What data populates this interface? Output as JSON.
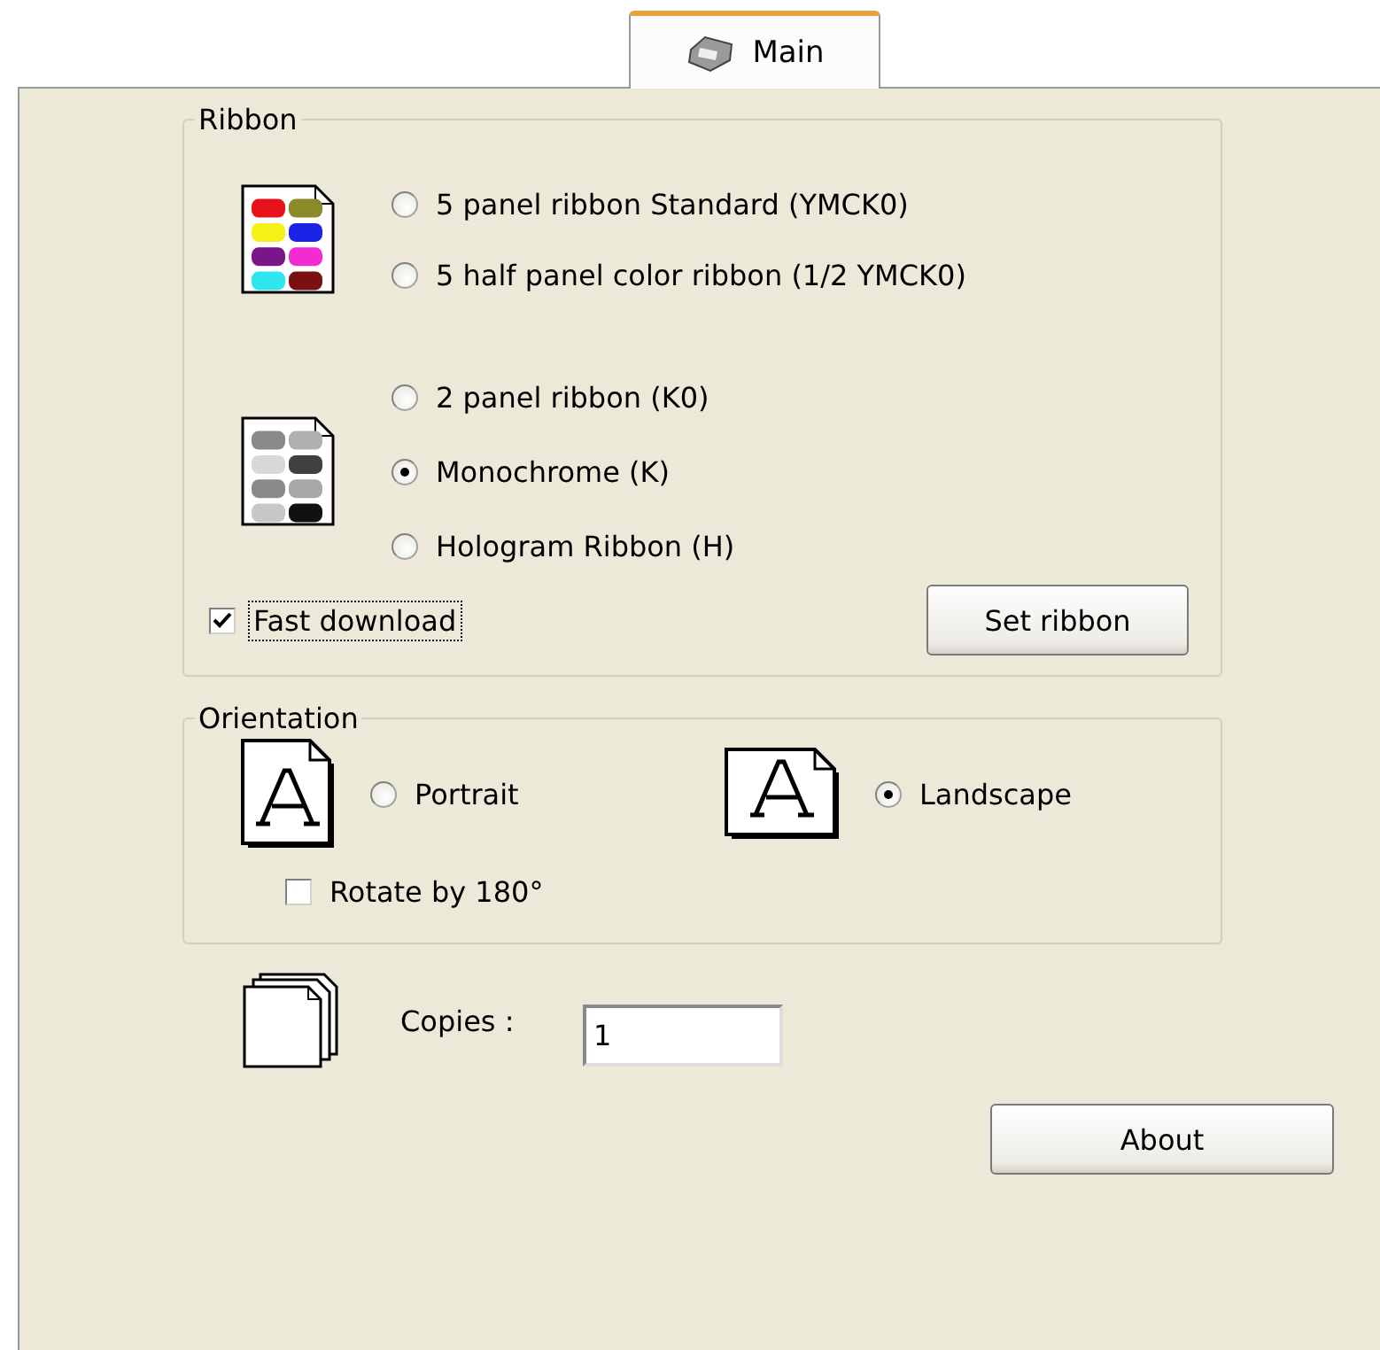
{
  "tabs": [
    {
      "label": "Main",
      "selected": true
    }
  ],
  "ribbon": {
    "title": "Ribbon",
    "groups": [
      {
        "kind": "color",
        "options": [
          {
            "label": "5 panel ribbon Standard (YMCK0)",
            "selected": false
          },
          {
            "label": "5 half panel color ribbon (1/2 YMCK0)",
            "selected": false
          }
        ]
      },
      {
        "kind": "mono",
        "options": [
          {
            "label": "2 panel ribbon (K0)",
            "selected": false
          },
          {
            "label": "Monochrome (K)",
            "selected": true
          },
          {
            "label": "Hologram Ribbon (H)",
            "selected": false
          }
        ]
      }
    ],
    "fast_download": {
      "label": "Fast download",
      "checked": true,
      "focused": true
    },
    "set_button": "Set ribbon"
  },
  "orientation": {
    "title": "Orientation",
    "options": [
      {
        "kind": "portrait",
        "label": "Portrait",
        "selected": false
      },
      {
        "kind": "landscape",
        "label": "Landscape",
        "selected": true
      }
    ],
    "rotate": {
      "label": "Rotate by 180°",
      "checked": false
    }
  },
  "copies": {
    "label": "Copies :",
    "value": "1"
  },
  "about_button": "About"
}
